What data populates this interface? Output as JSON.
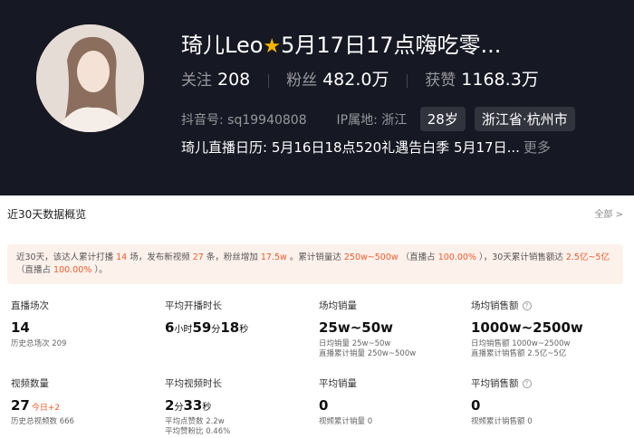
{
  "profile": {
    "name": "琦儿Leo",
    "name_tail": "5月17日17点嗨吃零...",
    "stats": [
      {
        "label": "关注",
        "value": "208"
      },
      {
        "label": "粉丝",
        "value": "482.0万"
      },
      {
        "label": "获赞",
        "value": "1168.3万"
      }
    ],
    "douyin_label": "抖音号:",
    "douyin_id": "sq19940808",
    "ip_label": "IP属地:",
    "ip_value": "浙江",
    "age_tag": "28岁",
    "location_tag": "浙江省·杭州市",
    "schedule": "琦儿直播日历:   5月16日18点520礼遇告白季 5月17日...",
    "more": "更多"
  },
  "overview": {
    "title": "近30天数据概览",
    "all_link": "全部 >",
    "summary_parts": [
      {
        "text": "近30天，该达人累计打播 ",
        "hl": false
      },
      {
        "text": "14",
        "hl": true
      },
      {
        "text": " 场，发布新视频 ",
        "hl": false
      },
      {
        "text": "27",
        "hl": true
      },
      {
        "text": " 条，粉丝增加 ",
        "hl": false
      },
      {
        "text": "17.5w",
        "hl": true
      },
      {
        "text": " 。累计销量达 ",
        "hl": false
      },
      {
        "text": "250w~500w",
        "hl": true
      },
      {
        "text": " （直播占 ",
        "hl": false
      },
      {
        "text": "100.00%",
        "hl": true
      },
      {
        "text": " ），30天累计销售额达 ",
        "hl": false
      },
      {
        "text": "2.5亿~5亿",
        "hl": true
      },
      {
        "text": "（直播占 ",
        "hl": false
      },
      {
        "text": "100.00%",
        "hl": true
      },
      {
        "text": " ）。",
        "hl": false
      }
    ]
  },
  "metrics": {
    "live_count": {
      "title": "直播场次",
      "value": "14",
      "detail": "历史总场次 209"
    },
    "live_duration": {
      "title": "平均开播时长",
      "v1": "6",
      "u1": "小时",
      "v2": "59",
      "u2": "分",
      "v3": "18",
      "u3": "秒"
    },
    "live_sales": {
      "title": "场均销量",
      "value": "25w~50w",
      "d1": "日均销量 25w~50w",
      "d2": "直播累计销量 250w~500w"
    },
    "live_gmv": {
      "title": "场均销售额",
      "value": "1000w~2500w",
      "d1": "日均销售额 1000w~2500w",
      "d2": "直播累计销售额 2.5亿~5亿"
    },
    "video_count": {
      "title": "视频数量",
      "value": "27",
      "plus": "今日+2",
      "detail": "历史总视频数 666"
    },
    "video_duration": {
      "title": "平均视频时长",
      "v1": "2",
      "u1": "分",
      "v2": "33",
      "u2": "秒",
      "d1": "平均点赞数 2.2w",
      "d2": "平均赞粉比 0.46%"
    },
    "video_sales": {
      "title": "平均销量",
      "value": "0",
      "detail": "视频累计销量 0"
    },
    "video_gmv": {
      "title": "平均销售额",
      "value": "0",
      "detail": "视频累计销售额 0"
    }
  }
}
